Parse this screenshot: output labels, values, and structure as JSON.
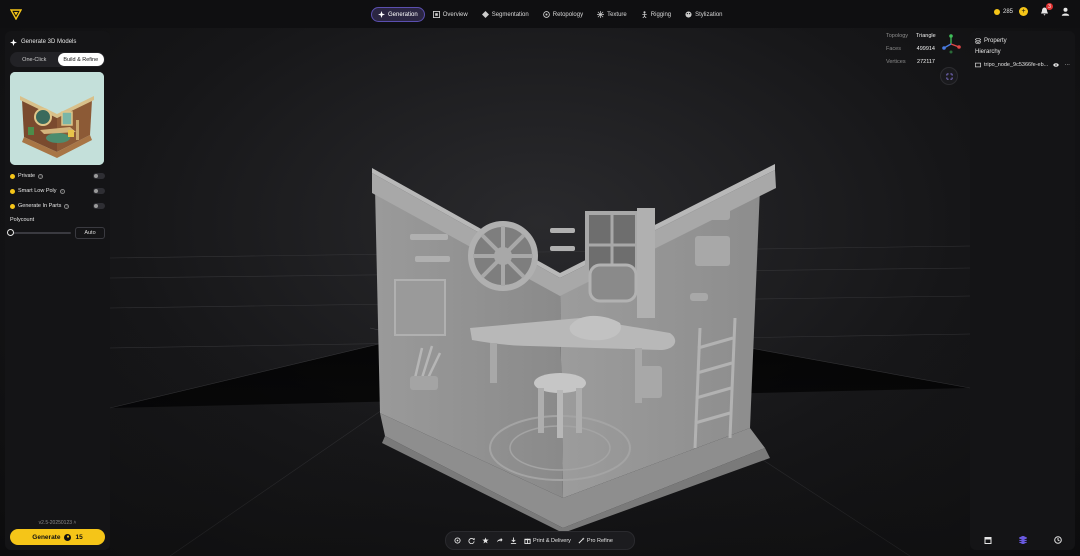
{
  "topbar": {
    "tabs": [
      {
        "label": "Generation",
        "icon": "sparkle-icon",
        "active": true
      },
      {
        "label": "Overview",
        "icon": "overview-icon",
        "active": false
      },
      {
        "label": "Segmentation",
        "icon": "segmentation-icon",
        "active": false
      },
      {
        "label": "Retopology",
        "icon": "retopology-icon",
        "active": false
      },
      {
        "label": "Texture",
        "icon": "texture-icon",
        "active": false
      },
      {
        "label": "Rigging",
        "icon": "rigging-icon",
        "active": false
      },
      {
        "label": "Stylization",
        "icon": "stylization-icon",
        "active": false
      }
    ],
    "credits": "285",
    "notification_count": "3"
  },
  "left_panel": {
    "title": "Generate 3D Models",
    "mode_tabs": [
      "One-Click",
      "Build & Refine"
    ],
    "selected_mode": "Build & Refine",
    "options": [
      {
        "label": "Private",
        "enabled": false
      },
      {
        "label": "Smart Low Poly",
        "enabled": false
      },
      {
        "label": "Generate In Parts",
        "enabled": false
      }
    ],
    "polycount_label": "Polycount",
    "polycount_value": "Auto",
    "version": "v2.5-20250123",
    "generate_label": "Generate",
    "generate_cost": "15"
  },
  "stats": {
    "topology_label": "Topology",
    "topology_value": "Triangle",
    "faces_label": "Faces",
    "faces_value": "499914",
    "vertices_label": "Vertices",
    "vertices_value": "272117"
  },
  "right_panel": {
    "property_label": "Property",
    "hierarchy_label": "Hierarchy",
    "node_name": "tripo_node_9c5366fe-eb..."
  },
  "bottom_toolbar": {
    "print_label": "Print & Delivery",
    "refine_label": "Pro Refine"
  },
  "colors": {
    "accent": "#f5c518",
    "active_tab": "#5b4fb0",
    "panel": "#141416"
  }
}
